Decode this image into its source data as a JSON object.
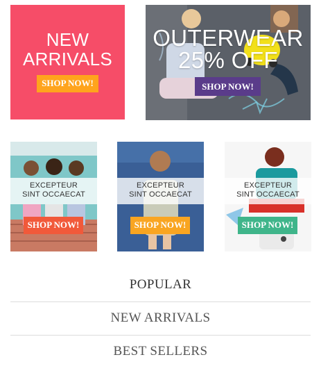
{
  "banners": {
    "new_arrivals": {
      "title_line1": "NEW",
      "title_line2": "ARRIVALS",
      "button": "SHOP NOW!",
      "bg": "#f64d68",
      "button_bg": "#ffa41d"
    },
    "outerwear": {
      "title_line1": "OUTERWEAR",
      "title_line2": "25% OFF",
      "button": "SHOP NOW!",
      "button_bg": "#5a3c8a"
    }
  },
  "cards": [
    {
      "line1": "EXCEPTEUR",
      "line2": "SINT OCCAECAT",
      "button": "SHOP NOW!",
      "button_bg": "#f1593a"
    },
    {
      "line1": "EXCEPTEUR",
      "line2": "SINT OCCAECAT",
      "button": "SHOP NOW!",
      "button_bg": "#f9a521"
    },
    {
      "line1": "EXCEPTEUR",
      "line2": "SINT OCCAECAT",
      "button": "SHOP NOW!",
      "button_bg": "#3fb58a"
    }
  ],
  "menu": [
    "POPULAR",
    "NEW ARRIVALS",
    "BEST SELLERS"
  ]
}
